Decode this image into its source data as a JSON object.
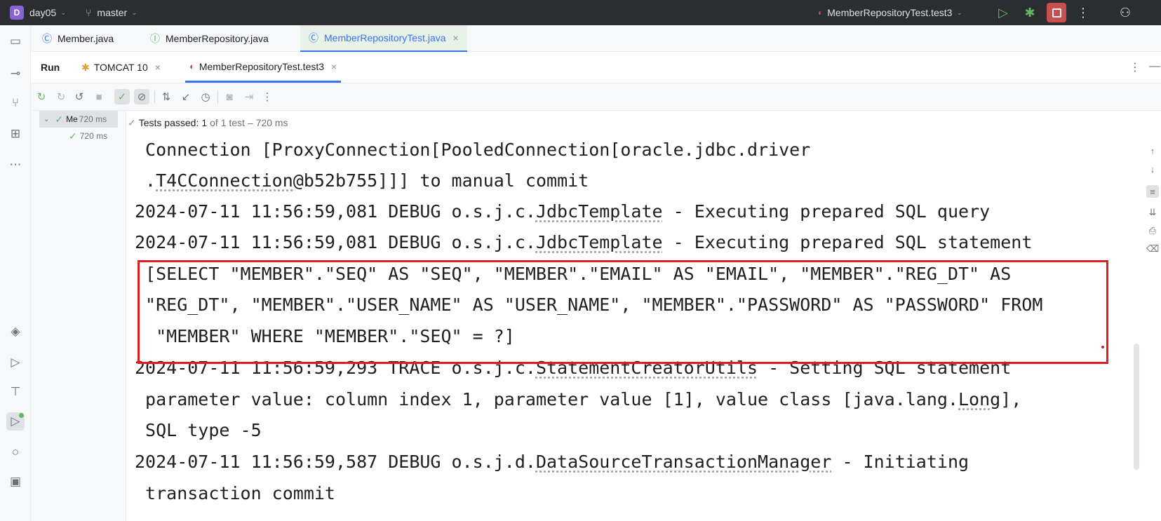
{
  "titlebar": {
    "project_initial": "D",
    "project": "day05",
    "branch": "master",
    "run_config": "MemberRepositoryTest.test3"
  },
  "editor_tabs": [
    {
      "label": "Member.java",
      "icon": "class-icon"
    },
    {
      "label": "MemberRepository.java",
      "icon": "interface-icon"
    },
    {
      "label": "MemberRepositoryTest.java",
      "icon": "test-class-icon",
      "active": true
    }
  ],
  "run_panel": {
    "title": "Run",
    "tabs": [
      {
        "label": "TOMCAT 10"
      },
      {
        "label": "MemberRepositoryTest.test3",
        "active": true
      }
    ]
  },
  "tree": {
    "root_label": "Me",
    "root_time": "720 ms",
    "child_time": "720 ms"
  },
  "status": {
    "passed_label": "Tests passed:",
    "passed_count": "1",
    "of_label": "of 1 test",
    "duration": "– 720 ms"
  },
  "console": {
    "l1": " Connection [ProxyConnection[PooledConnection[oracle.jdbc.driver",
    "l2_prefix": " .",
    "l2_ul": "T4CConnection",
    "l2_suffix": "@b52b755]]] to manual commit",
    "l3_prefix": "2024-07-11 11:56:59,081 DEBUG o.s.j.c.",
    "l3_ul": "JdbcTemplate",
    "l3_suffix": " - Executing prepared SQL query",
    "l4_prefix": "2024-07-11 11:56:59,081 DEBUG o.s.j.c.",
    "l4_ul": "JdbcTemplate",
    "l4_suffix": " - Executing prepared SQL statement",
    "l5": " [SELECT \"MEMBER\".\"SEQ\" AS \"SEQ\", \"MEMBER\".\"EMAIL\" AS \"EMAIL\", \"MEMBER\".\"REG_DT\" AS",
    "l6": " \"REG_DT\", \"MEMBER\".\"USER_NAME\" AS \"USER_NAME\", \"MEMBER\".\"PASSWORD\" AS \"PASSWORD\" FROM",
    "l7": "  \"MEMBER\" WHERE \"MEMBER\".\"SEQ\" = ?]",
    "l8_prefix": "2024-07-11 11:56:59,293 TRACE o.s.j.c.",
    "l8_ul": "StatementCreatorUtils",
    "l8_suffix": " - Setting SQL statement",
    "l9_prefix": " parameter value: column index 1, parameter value [1], value class [java.lang.",
    "l9_ul": "Long",
    "l9_suffix": "],",
    "l10": " SQL type -5",
    "l11_prefix": "2024-07-11 11:56:59,587 DEBUG o.s.j.d.",
    "l11_ul": "DataSourceTransactionManager",
    "l11_suffix": " - Initiating",
    "l12": " transaction commit"
  },
  "colors": {
    "highlight": "#e01b24",
    "accent": "#3574f0",
    "success": "#5fb865"
  }
}
